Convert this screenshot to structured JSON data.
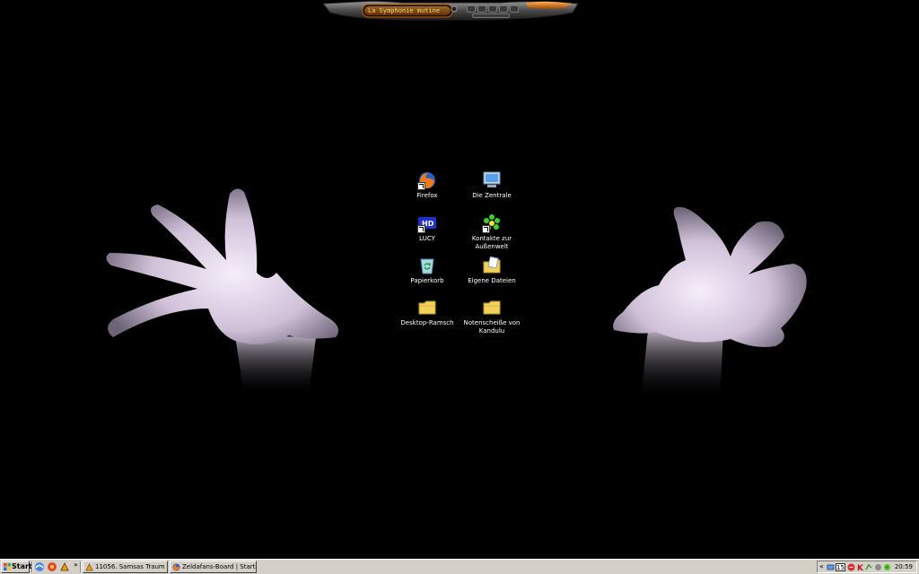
{
  "media_player": {
    "title_text": "La Symphonie mutine"
  },
  "desktop": {
    "background_color": "#000000",
    "icons": [
      {
        "label": "Firefox",
        "icon": "firefox-icon"
      },
      {
        "label": "Die Zentrale",
        "icon": "computer-icon"
      },
      {
        "label": "LUCY",
        "icon": "hd-drive-icon"
      },
      {
        "label": "Kontakte zur Außenwelt",
        "icon": "icq-flower-icon"
      },
      {
        "label": "Papierkorb",
        "icon": "recycle-bin-icon"
      },
      {
        "label": "Eigene Dateien",
        "icon": "documents-folder-icon"
      },
      {
        "label": "Desktop-Ramsch",
        "icon": "folder-icon"
      },
      {
        "label": "Notenscheiße von Kandulu",
        "icon": "folder-icon"
      }
    ]
  },
  "taskbar": {
    "start_label": "Start",
    "chevron": "»",
    "tasks": [
      {
        "label": "11056. Samsas Traum - ...",
        "icon": "winamp-icon"
      },
      {
        "label": "Zeldafans-Board | Starts...",
        "icon": "firefox-icon"
      }
    ],
    "tray": {
      "expand": "«",
      "badge": "15",
      "clock": "20:59"
    }
  }
}
